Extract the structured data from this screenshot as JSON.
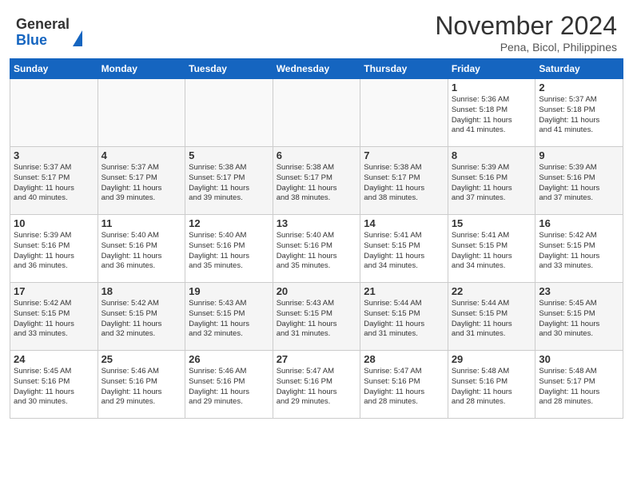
{
  "logo": {
    "general": "General",
    "blue": "Blue"
  },
  "title": {
    "month_year": "November 2024",
    "location": "Pena, Bicol, Philippines"
  },
  "columns": [
    "Sunday",
    "Monday",
    "Tuesday",
    "Wednesday",
    "Thursday",
    "Friday",
    "Saturday"
  ],
  "weeks": [
    {
      "days": [
        {
          "date": "",
          "info": ""
        },
        {
          "date": "",
          "info": ""
        },
        {
          "date": "",
          "info": ""
        },
        {
          "date": "",
          "info": ""
        },
        {
          "date": "",
          "info": ""
        },
        {
          "date": "1",
          "info": "Sunrise: 5:36 AM\nSunset: 5:18 PM\nDaylight: 11 hours\nand 41 minutes."
        },
        {
          "date": "2",
          "info": "Sunrise: 5:37 AM\nSunset: 5:18 PM\nDaylight: 11 hours\nand 41 minutes."
        }
      ]
    },
    {
      "days": [
        {
          "date": "3",
          "info": "Sunrise: 5:37 AM\nSunset: 5:17 PM\nDaylight: 11 hours\nand 40 minutes."
        },
        {
          "date": "4",
          "info": "Sunrise: 5:37 AM\nSunset: 5:17 PM\nDaylight: 11 hours\nand 39 minutes."
        },
        {
          "date": "5",
          "info": "Sunrise: 5:38 AM\nSunset: 5:17 PM\nDaylight: 11 hours\nand 39 minutes."
        },
        {
          "date": "6",
          "info": "Sunrise: 5:38 AM\nSunset: 5:17 PM\nDaylight: 11 hours\nand 38 minutes."
        },
        {
          "date": "7",
          "info": "Sunrise: 5:38 AM\nSunset: 5:17 PM\nDaylight: 11 hours\nand 38 minutes."
        },
        {
          "date": "8",
          "info": "Sunrise: 5:39 AM\nSunset: 5:16 PM\nDaylight: 11 hours\nand 37 minutes."
        },
        {
          "date": "9",
          "info": "Sunrise: 5:39 AM\nSunset: 5:16 PM\nDaylight: 11 hours\nand 37 minutes."
        }
      ]
    },
    {
      "days": [
        {
          "date": "10",
          "info": "Sunrise: 5:39 AM\nSunset: 5:16 PM\nDaylight: 11 hours\nand 36 minutes."
        },
        {
          "date": "11",
          "info": "Sunrise: 5:40 AM\nSunset: 5:16 PM\nDaylight: 11 hours\nand 36 minutes."
        },
        {
          "date": "12",
          "info": "Sunrise: 5:40 AM\nSunset: 5:16 PM\nDaylight: 11 hours\nand 35 minutes."
        },
        {
          "date": "13",
          "info": "Sunrise: 5:40 AM\nSunset: 5:16 PM\nDaylight: 11 hours\nand 35 minutes."
        },
        {
          "date": "14",
          "info": "Sunrise: 5:41 AM\nSunset: 5:15 PM\nDaylight: 11 hours\nand 34 minutes."
        },
        {
          "date": "15",
          "info": "Sunrise: 5:41 AM\nSunset: 5:15 PM\nDaylight: 11 hours\nand 34 minutes."
        },
        {
          "date": "16",
          "info": "Sunrise: 5:42 AM\nSunset: 5:15 PM\nDaylight: 11 hours\nand 33 minutes."
        }
      ]
    },
    {
      "days": [
        {
          "date": "17",
          "info": "Sunrise: 5:42 AM\nSunset: 5:15 PM\nDaylight: 11 hours\nand 33 minutes."
        },
        {
          "date": "18",
          "info": "Sunrise: 5:42 AM\nSunset: 5:15 PM\nDaylight: 11 hours\nand 32 minutes."
        },
        {
          "date": "19",
          "info": "Sunrise: 5:43 AM\nSunset: 5:15 PM\nDaylight: 11 hours\nand 32 minutes."
        },
        {
          "date": "20",
          "info": "Sunrise: 5:43 AM\nSunset: 5:15 PM\nDaylight: 11 hours\nand 31 minutes."
        },
        {
          "date": "21",
          "info": "Sunrise: 5:44 AM\nSunset: 5:15 PM\nDaylight: 11 hours\nand 31 minutes."
        },
        {
          "date": "22",
          "info": "Sunrise: 5:44 AM\nSunset: 5:15 PM\nDaylight: 11 hours\nand 31 minutes."
        },
        {
          "date": "23",
          "info": "Sunrise: 5:45 AM\nSunset: 5:15 PM\nDaylight: 11 hours\nand 30 minutes."
        }
      ]
    },
    {
      "days": [
        {
          "date": "24",
          "info": "Sunrise: 5:45 AM\nSunset: 5:16 PM\nDaylight: 11 hours\nand 30 minutes."
        },
        {
          "date": "25",
          "info": "Sunrise: 5:46 AM\nSunset: 5:16 PM\nDaylight: 11 hours\nand 29 minutes."
        },
        {
          "date": "26",
          "info": "Sunrise: 5:46 AM\nSunset: 5:16 PM\nDaylight: 11 hours\nand 29 minutes."
        },
        {
          "date": "27",
          "info": "Sunrise: 5:47 AM\nSunset: 5:16 PM\nDaylight: 11 hours\nand 29 minutes."
        },
        {
          "date": "28",
          "info": "Sunrise: 5:47 AM\nSunset: 5:16 PM\nDaylight: 11 hours\nand 28 minutes."
        },
        {
          "date": "29",
          "info": "Sunrise: 5:48 AM\nSunset: 5:16 PM\nDaylight: 11 hours\nand 28 minutes."
        },
        {
          "date": "30",
          "info": "Sunrise: 5:48 AM\nSunset: 5:17 PM\nDaylight: 11 hours\nand 28 minutes."
        }
      ]
    }
  ]
}
